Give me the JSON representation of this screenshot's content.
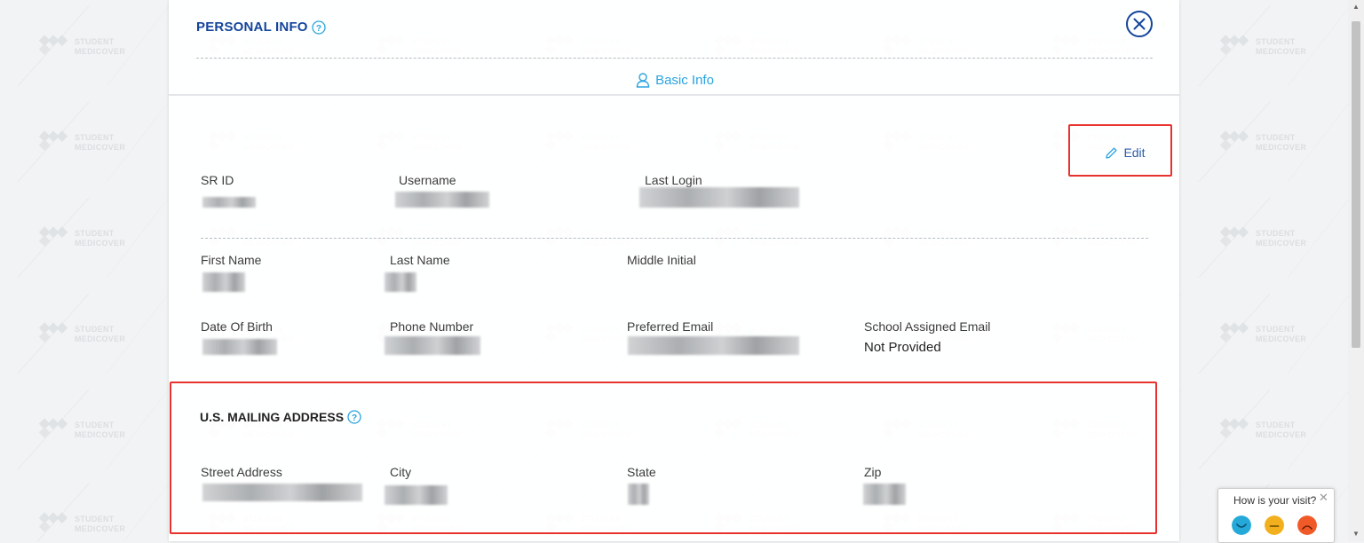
{
  "panel": {
    "title": "PERSONAL INFO",
    "tab_label": "Basic Info",
    "edit_label": "Edit"
  },
  "watermark": {
    "line1": "STUDENT",
    "line2": "MEDICOVER"
  },
  "basic": {
    "sr_id_label": "SR ID",
    "username_label": "Username",
    "last_login_label": "Last Login",
    "first_name_label": "First Name",
    "last_name_label": "Last Name",
    "middle_initial_label": "Middle Initial",
    "dob_label": "Date Of Birth",
    "phone_label": "Phone Number",
    "preferred_email_label": "Preferred Email",
    "school_email_label": "School Assigned Email",
    "school_email_value": "Not Provided"
  },
  "mailing": {
    "title": "U.S. MAILING ADDRESS",
    "street_label": "Street Address",
    "city_label": "City",
    "state_label": "State",
    "zip_label": "Zip"
  },
  "feedback": {
    "question": "How is your visit?",
    "close": "✕"
  },
  "colors": {
    "title_blue": "#14459b",
    "tab_blue": "#2aa3df",
    "highlight_red": "#e8322e"
  }
}
